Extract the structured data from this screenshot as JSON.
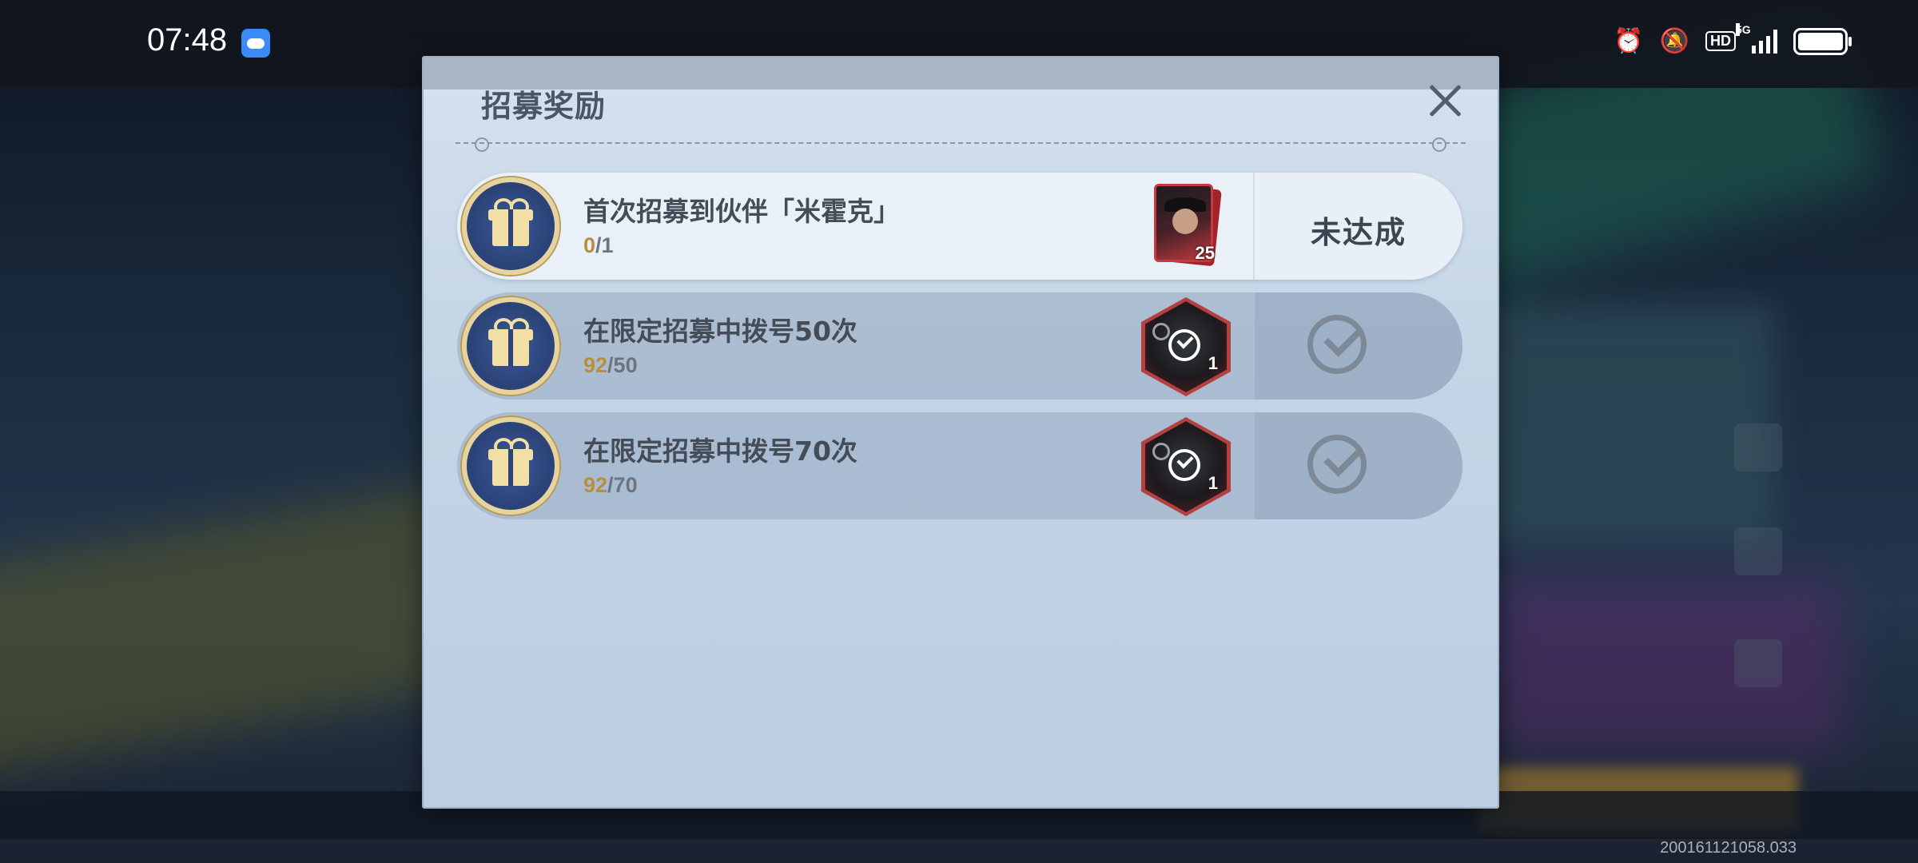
{
  "status_bar": {
    "time": "07:48",
    "network": "5G",
    "hd_badge": "HD",
    "icons": [
      "weather-icon",
      "alarm-icon",
      "silent-icon",
      "hd-icon",
      "signal-icon",
      "battery-icon"
    ]
  },
  "modal": {
    "title": "招募奖励",
    "rows": [
      {
        "task": "首次招募到伙伴「米霍克」",
        "current": "0",
        "target": "/1",
        "reward_count": "25",
        "reward_type": "partner-card",
        "status": "未达成",
        "claimed": false
      },
      {
        "task": "在限定招募中拨号50次",
        "current": "92",
        "target": "/50",
        "reward_count": "1",
        "reward_type": "hex-token",
        "claimed": true
      },
      {
        "task": "在限定招募中拨号70次",
        "current": "92",
        "target": "/70",
        "reward_count": "1",
        "reward_type": "hex-token",
        "claimed": true
      }
    ]
  },
  "version": "200161121058.033",
  "colors": {
    "progress_current": "#b88f3a",
    "modal_bg": "#c5d5e6",
    "claimed_check": "#7e8997"
  }
}
